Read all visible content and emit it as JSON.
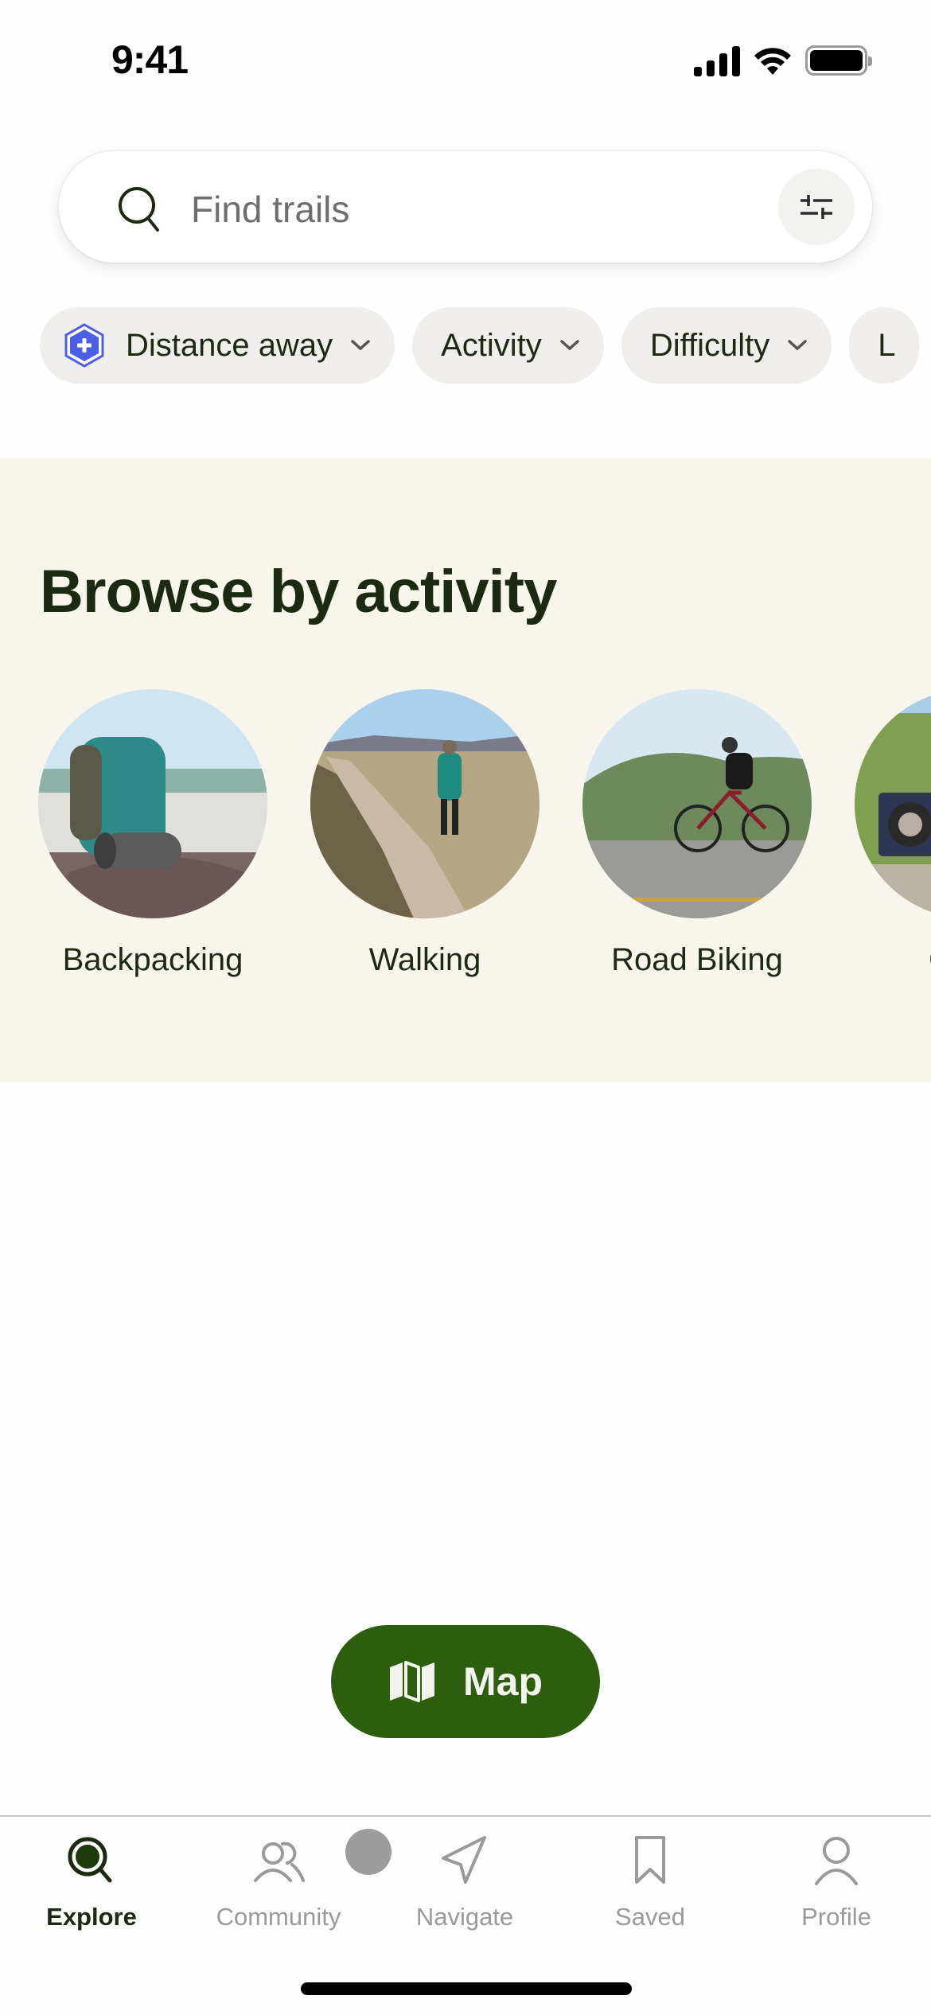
{
  "status_bar": {
    "time": "9:41",
    "icons": [
      "signal-icon",
      "wifi-icon",
      "battery-icon"
    ]
  },
  "search": {
    "placeholder": "Find trails",
    "search_icon": "search-icon",
    "filter_icon": "sliders-icon"
  },
  "filter_chips": [
    {
      "label": "Distance away",
      "icon": "plus-hexagon-icon",
      "icon_color": "#4a5ee6"
    },
    {
      "label": "Activity"
    },
    {
      "label": "Difficulty"
    },
    {
      "label": "L"
    }
  ],
  "browse": {
    "title": "Browse by activity",
    "activities": [
      {
        "label": "Backpacking",
        "image": "backpack on rock by lake"
      },
      {
        "label": "Walking",
        "image": "person walking on boardwalk"
      },
      {
        "label": "Road Biking",
        "image": "cyclist on road"
      },
      {
        "label": "Off-ro",
        "image": "off-road vehicle on hillside"
      }
    ]
  },
  "map_button": {
    "label": "Map",
    "icon": "map-icon"
  },
  "tab_bar": {
    "tabs": [
      {
        "label": "Explore",
        "icon": "explore-search-icon",
        "active": true
      },
      {
        "label": "Community",
        "icon": "community-icon",
        "active": false
      },
      {
        "label": "Navigate",
        "icon": "navigate-arrow-icon",
        "active": false
      },
      {
        "label": "Saved",
        "icon": "bookmark-icon",
        "active": false
      },
      {
        "label": "Profile",
        "icon": "profile-icon",
        "active": false
      }
    ]
  },
  "colors": {
    "brand_green": "#2d5e0e",
    "text_dark": "#1c2a10",
    "section_bg": "#f7f5ec",
    "chip_bg": "#f0efed",
    "inactive_tab": "#9a9a9a",
    "badge_blue": "#4a5ee6"
  }
}
